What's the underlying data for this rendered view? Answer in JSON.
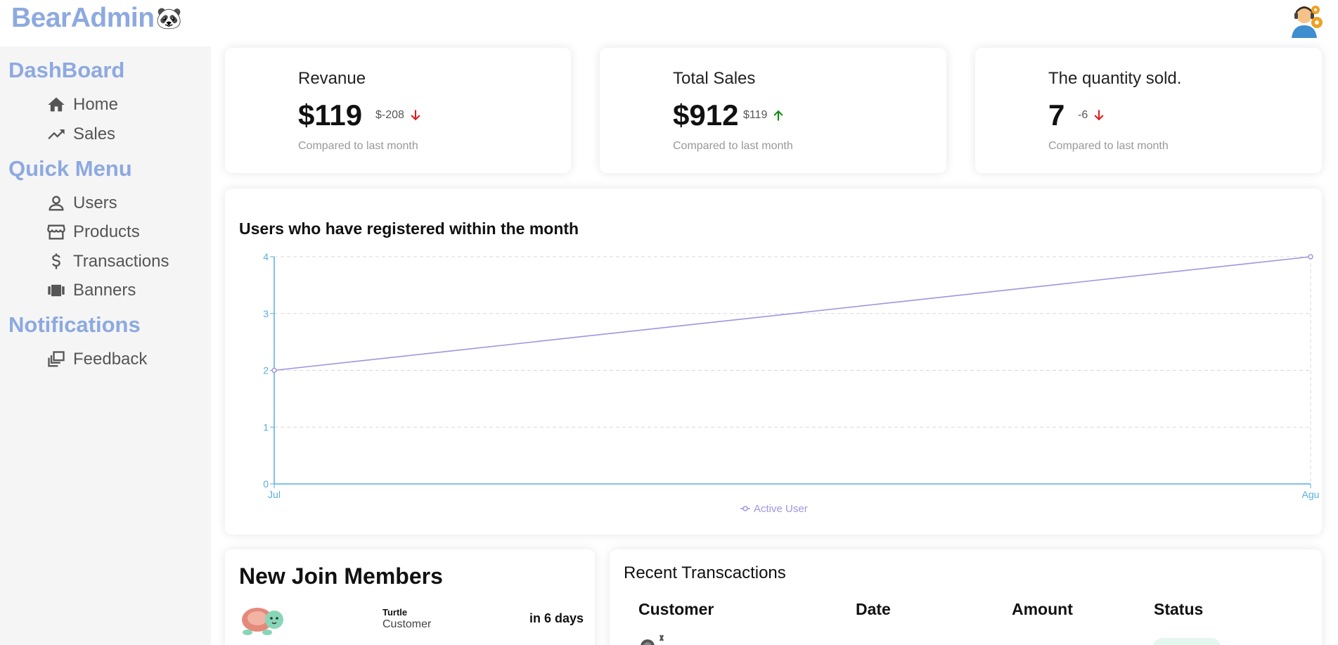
{
  "app": {
    "logo_text": "BearAdmin",
    "logo_emoji": "🐼"
  },
  "sidebar": {
    "sections": [
      {
        "title": "DashBoard",
        "items": [
          {
            "label": "Home",
            "icon": "home-icon"
          },
          {
            "label": "Sales",
            "icon": "trending-up-icon"
          }
        ]
      },
      {
        "title": "Quick Menu",
        "items": [
          {
            "label": "Users",
            "icon": "user-icon"
          },
          {
            "label": "Products",
            "icon": "storefront-icon"
          },
          {
            "label": "Transactions",
            "icon": "dollar-icon"
          },
          {
            "label": "Banners",
            "icon": "banner-icon"
          }
        ]
      },
      {
        "title": "Notifications",
        "items": [
          {
            "label": "Feedback",
            "icon": "feedback-icon"
          }
        ]
      }
    ]
  },
  "stats": [
    {
      "title": "Revanue",
      "value": "$119",
      "delta": "$-208",
      "trend": "down",
      "subtitle": "Compared to last month"
    },
    {
      "title": "Total Sales",
      "value": "$912",
      "delta": "$119",
      "trend": "up",
      "subtitle": "Compared to last month"
    },
    {
      "title": "The quantity sold.",
      "value": "7",
      "delta": "-6",
      "trend": "down",
      "subtitle": "Compared to last month"
    }
  ],
  "colors": {
    "accent": "#8da9e0",
    "line": "#9f95e0",
    "axis": "#5aaee0",
    "down": "#e01b1b",
    "up": "#138a13"
  },
  "chart": {
    "title": "Users who have registered within the month"
  },
  "chart_data": {
    "type": "line",
    "categories": [
      "Jul",
      "Agu"
    ],
    "series": [
      {
        "name": "Active User",
        "values": [
          2,
          4
        ]
      }
    ],
    "ylim": [
      0,
      4
    ],
    "yticks": [
      "0",
      "1",
      "2",
      "3",
      "4"
    ],
    "grid": true,
    "legend": "bottom"
  },
  "members": {
    "title": "New Join Members",
    "rows": [
      {
        "name": "Turtle",
        "role": "Customer",
        "when": "in 6 days",
        "avatar": "turtle-icon"
      }
    ]
  },
  "transactions": {
    "title": "Recent Transcactions",
    "columns": [
      "Customer",
      "Date",
      "Amount",
      "Status"
    ]
  }
}
